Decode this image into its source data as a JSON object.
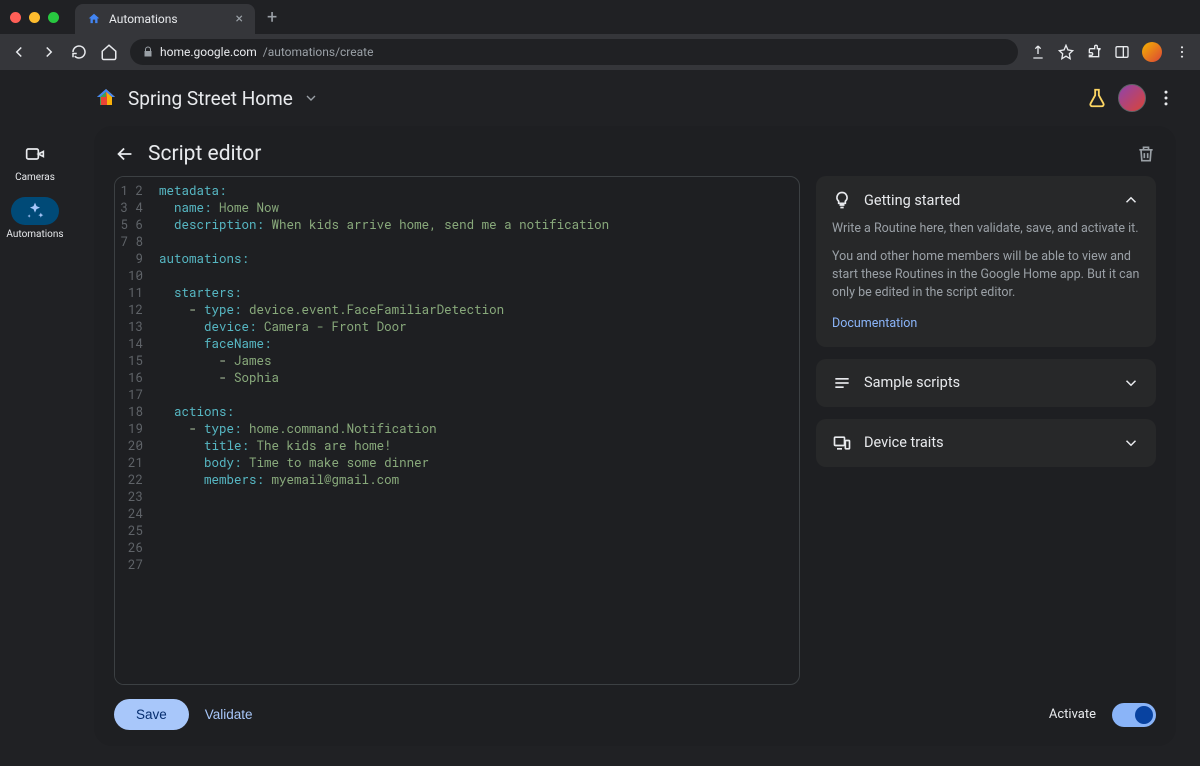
{
  "browser": {
    "tab_title": "Automations",
    "url_domain": "home.google.com",
    "url_path": "/automations/create"
  },
  "sidebar": {
    "items": [
      {
        "label": "Cameras",
        "icon": "camera"
      },
      {
        "label": "Automations",
        "icon": "sparkle"
      }
    ]
  },
  "header": {
    "home_name": "Spring Street Home"
  },
  "page": {
    "title": "Script editor"
  },
  "code": {
    "lines": 27,
    "content": {
      "metadata_key": "metadata:",
      "name_key": "name:",
      "name_val": "Home Now",
      "description_key": "description:",
      "description_val": "When kids arrive home, send me a notification",
      "automations_key": "automations:",
      "starters_key": "starters:",
      "type_key": "type:",
      "starter_type_val": "device.event.FaceFamiliarDetection",
      "device_key": "device:",
      "device_val": "Camera - Front Door",
      "faceName_key": "faceName:",
      "face1": "James",
      "face2": "Sophia",
      "actions_key": "actions:",
      "action_type_val": "home.command.Notification",
      "title_key": "title:",
      "title_val": "The kids are home!",
      "body_key": "body:",
      "body_val": "Time to make some dinner",
      "members_key": "members:",
      "members_val": "myemail@gmail.com"
    }
  },
  "help_panel": {
    "getting_started": {
      "title": "Getting started",
      "line1": "Write a Routine here, then validate, save, and activate it.",
      "line2": "You and other home members will be able to view and start these Routines in the Google Home app. But it can only be edited in the script editor.",
      "link": "Documentation"
    },
    "sample_scripts": {
      "title": "Sample scripts"
    },
    "device_traits": {
      "title": "Device traits"
    }
  },
  "footer": {
    "save_label": "Save",
    "validate_label": "Validate",
    "activate_label": "Activate",
    "activate_state": true
  }
}
